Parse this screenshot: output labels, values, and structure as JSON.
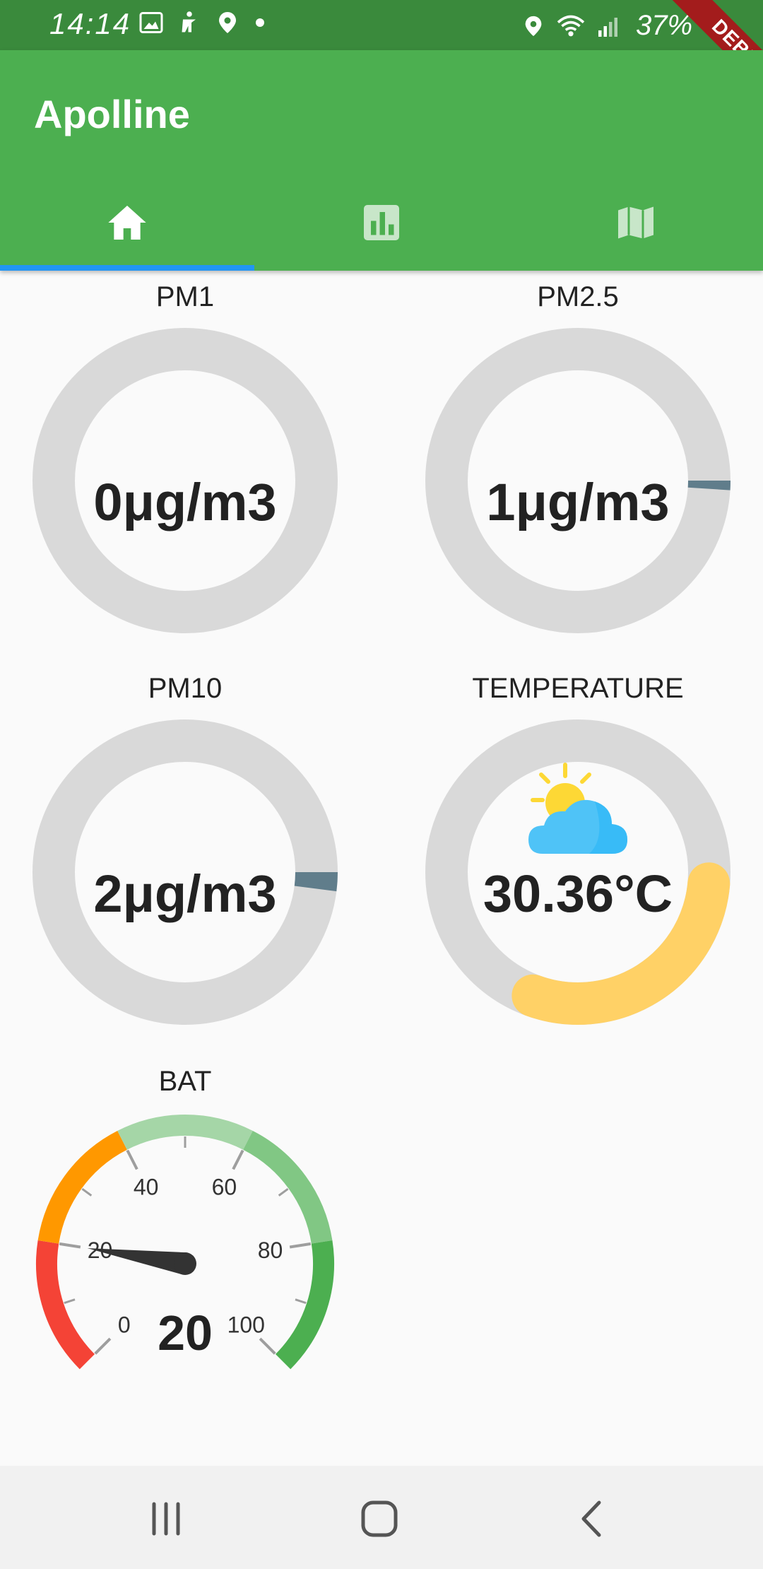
{
  "status_bar": {
    "time": "14:14",
    "battery": "37%",
    "debug_label": "DEBUG"
  },
  "app_bar": {
    "title": "Apolline",
    "tabs": [
      {
        "icon": "home-icon",
        "selected": true
      },
      {
        "icon": "bar-chart-icon",
        "selected": false
      },
      {
        "icon": "map-icon",
        "selected": false
      }
    ]
  },
  "gauges": {
    "pm1": {
      "label": "PM1",
      "value": "0μg/m3",
      "fraction": 0.0
    },
    "pm25": {
      "label": "PM2.5",
      "value": "1μg/m3",
      "fraction": 0.01
    },
    "pm10": {
      "label": "PM10",
      "value": "2μg/m3",
      "fraction": 0.02
    },
    "temperature": {
      "label": "TEMPERATURE",
      "value": "30.36°C",
      "fraction": 0.3,
      "icon": "partly-cloudy-icon"
    }
  },
  "battery_gauge": {
    "label": "BAT",
    "value": "20",
    "min": 0,
    "max": 100,
    "ticks": [
      "0",
      "20",
      "40",
      "60",
      "80",
      "100"
    ],
    "colors": {
      "red": "#f44336",
      "orange": "#ff9800",
      "light_green": "#a5d6a7",
      "green": "#81c784",
      "dark_green": "#4caf50"
    }
  },
  "colors": {
    "primary": "#4caf50",
    "status_bar": "#3a8a3c",
    "tab_indicator": "#2196f3",
    "ring_track": "#d9d9d9",
    "pm_fill": "#607d8b",
    "temp_fill": "#ffd166"
  }
}
